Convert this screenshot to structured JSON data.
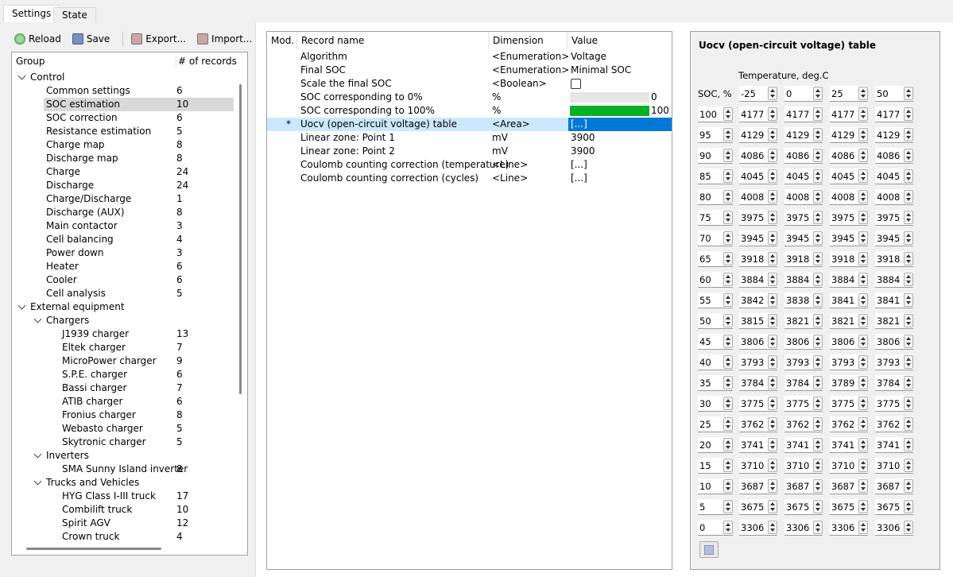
{
  "tabs": [
    {
      "label": "Settings",
      "active": true
    },
    {
      "label": "State",
      "active": false
    }
  ],
  "toolbar": {
    "reload_label": "Reload",
    "save_label": "Save",
    "export_label": "Export...",
    "import_label": "Import..."
  },
  "tree": {
    "col_group": "Group",
    "col_records": "# of records",
    "rows": [
      {
        "label": "Control",
        "count": "",
        "level": 0,
        "expanded": true
      },
      {
        "label": "Common settings",
        "count": "6",
        "level": 1
      },
      {
        "label": "SOC estimation",
        "count": "10",
        "level": 1,
        "selected": true
      },
      {
        "label": "SOC correction",
        "count": "6",
        "level": 1
      },
      {
        "label": "Resistance estimation",
        "count": "5",
        "level": 1
      },
      {
        "label": "Charge map",
        "count": "8",
        "level": 1
      },
      {
        "label": "Discharge map",
        "count": "8",
        "level": 1
      },
      {
        "label": "Charge",
        "count": "24",
        "level": 1
      },
      {
        "label": "Discharge",
        "count": "24",
        "level": 1
      },
      {
        "label": "Charge/Discharge",
        "count": "1",
        "level": 1
      },
      {
        "label": "Discharge (AUX)",
        "count": "8",
        "level": 1
      },
      {
        "label": "Main contactor",
        "count": "3",
        "level": 1
      },
      {
        "label": "Cell balancing",
        "count": "4",
        "level": 1
      },
      {
        "label": "Power down",
        "count": "3",
        "level": 1
      },
      {
        "label": "Heater",
        "count": "6",
        "level": 1
      },
      {
        "label": "Cooler",
        "count": "6",
        "level": 1
      },
      {
        "label": "Cell analysis",
        "count": "5",
        "level": 1
      },
      {
        "label": "External equipment",
        "count": "",
        "level": 0,
        "expanded": true
      },
      {
        "label": "Chargers",
        "count": "",
        "level": 1,
        "expanded": true
      },
      {
        "label": "J1939 charger",
        "count": "13",
        "level": 2
      },
      {
        "label": "Eltek charger",
        "count": "7",
        "level": 2
      },
      {
        "label": "MicroPower charger",
        "count": "9",
        "level": 2
      },
      {
        "label": "S.P.E. charger",
        "count": "6",
        "level": 2
      },
      {
        "label": "Bassi charger",
        "count": "7",
        "level": 2
      },
      {
        "label": "ATIB charger",
        "count": "6",
        "level": 2
      },
      {
        "label": "Fronius charger",
        "count": "8",
        "level": 2
      },
      {
        "label": "Webasto charger",
        "count": "5",
        "level": 2
      },
      {
        "label": "Skytronic charger",
        "count": "5",
        "level": 2
      },
      {
        "label": "Inverters",
        "count": "",
        "level": 1,
        "expanded": true
      },
      {
        "label": "SMA Sunny Island inverter",
        "count": "8",
        "level": 2
      },
      {
        "label": "Trucks and Vehicles",
        "count": "",
        "level": 1,
        "expanded": true
      },
      {
        "label": "HYG Class I-III truck",
        "count": "17",
        "level": 2
      },
      {
        "label": "Combilift truck",
        "count": "10",
        "level": 2
      },
      {
        "label": "Spirit AGV",
        "count": "12",
        "level": 2
      },
      {
        "label": "Crown truck",
        "count": "4",
        "level": 2
      }
    ]
  },
  "records": {
    "col_mod": "Mod.",
    "col_name": "Record name",
    "col_dim": "Dimension",
    "col_value": "Value",
    "rows": [
      {
        "mod": "",
        "name": "Algorithm",
        "dim": "<Enumeration>",
        "value": "Voltage",
        "kind": "text"
      },
      {
        "mod": "",
        "name": "Final SOC",
        "dim": "<Enumeration>",
        "value": "Minimal SOC",
        "kind": "text"
      },
      {
        "mod": "",
        "name": "Scale the final SOC",
        "dim": "<Boolean>",
        "value": "",
        "kind": "checkbox"
      },
      {
        "mod": "",
        "name": "SOC corresponding to 0%",
        "dim": "%",
        "value": "0",
        "kind": "bar",
        "level": 0
      },
      {
        "mod": "",
        "name": "SOC corresponding to 100%",
        "dim": "%",
        "value": "100",
        "kind": "bar",
        "level": 100
      },
      {
        "mod": "*",
        "name": "Uocv (open-circuit voltage) table",
        "dim": "<Area>",
        "value": "[...]",
        "kind": "text",
        "selected": true
      },
      {
        "mod": "",
        "name": "Linear zone: Point 1",
        "dim": "mV",
        "value": "3900",
        "kind": "text"
      },
      {
        "mod": "",
        "name": "Linear zone: Point 2",
        "dim": "mV",
        "value": "3900",
        "kind": "text"
      },
      {
        "mod": "",
        "name": "Coulomb counting correction (temperature)",
        "dim": "<Line>",
        "value": "[...]",
        "kind": "text"
      },
      {
        "mod": "",
        "name": "Coulomb counting correction (cycles)",
        "dim": "<Line>",
        "value": "[...]",
        "kind": "text"
      }
    ]
  },
  "uocv": {
    "title": "Uocv (open-circuit voltage) table",
    "temp_label": "Temperature, deg.C",
    "soc_label": "SOC, %",
    "temperatures": [
      "-25",
      "0",
      "25",
      "50"
    ],
    "rows": [
      {
        "soc": "100",
        "v": [
          "4177",
          "4177",
          "4177",
          "4177"
        ]
      },
      {
        "soc": "95",
        "v": [
          "4129",
          "4129",
          "4129",
          "4129"
        ]
      },
      {
        "soc": "90",
        "v": [
          "4086",
          "4086",
          "4086",
          "4086"
        ]
      },
      {
        "soc": "85",
        "v": [
          "4045",
          "4045",
          "4045",
          "4045"
        ]
      },
      {
        "soc": "80",
        "v": [
          "4008",
          "4008",
          "4008",
          "4008"
        ]
      },
      {
        "soc": "75",
        "v": [
          "3975",
          "3975",
          "3975",
          "3975"
        ]
      },
      {
        "soc": "70",
        "v": [
          "3945",
          "3945",
          "3945",
          "3945"
        ]
      },
      {
        "soc": "65",
        "v": [
          "3918",
          "3918",
          "3918",
          "3918"
        ]
      },
      {
        "soc": "60",
        "v": [
          "3884",
          "3884",
          "3884",
          "3884"
        ]
      },
      {
        "soc": "55",
        "v": [
          "3842",
          "3838",
          "3841",
          "3841"
        ]
      },
      {
        "soc": "50",
        "v": [
          "3815",
          "3821",
          "3821",
          "3821"
        ]
      },
      {
        "soc": "45",
        "v": [
          "3806",
          "3806",
          "3806",
          "3806"
        ]
      },
      {
        "soc": "40",
        "v": [
          "3793",
          "3793",
          "3793",
          "3793"
        ]
      },
      {
        "soc": "35",
        "v": [
          "3784",
          "3784",
          "3789",
          "3784"
        ]
      },
      {
        "soc": "30",
        "v": [
          "3775",
          "3775",
          "3775",
          "3775"
        ]
      },
      {
        "soc": "25",
        "v": [
          "3762",
          "3762",
          "3762",
          "3762"
        ]
      },
      {
        "soc": "20",
        "v": [
          "3741",
          "3741",
          "3741",
          "3741"
        ]
      },
      {
        "soc": "15",
        "v": [
          "3710",
          "3710",
          "3710",
          "3710"
        ]
      },
      {
        "soc": "10",
        "v": [
          "3687",
          "3687",
          "3687",
          "3687"
        ]
      },
      {
        "soc": "5",
        "v": [
          "3675",
          "3675",
          "3675",
          "3675"
        ]
      },
      {
        "soc": "0",
        "v": [
          "3306",
          "3306",
          "3306",
          "3306"
        ]
      }
    ]
  },
  "colors": {
    "selection": "#0078d7",
    "row_highlight": "#cce8ff",
    "progress": "#06b025"
  }
}
